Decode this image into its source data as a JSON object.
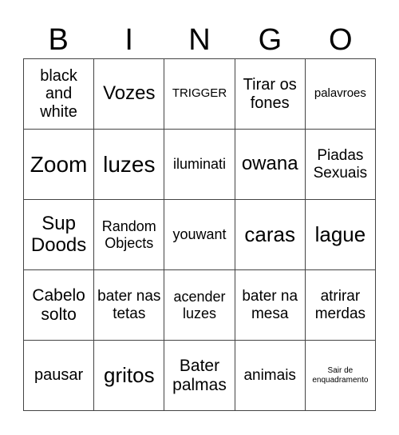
{
  "header": [
    "B",
    "I",
    "N",
    "G",
    "O"
  ],
  "cells": [
    [
      "black and white",
      "Vozes",
      "TRIGGER",
      "Tirar os fones",
      "palavroes"
    ],
    [
      "Zoom",
      "luzes",
      "iluminati",
      "owana",
      "Piadas Sexuais"
    ],
    [
      "Sup Doods",
      "Random Objects",
      "youwant",
      "caras",
      "lague"
    ],
    [
      "Cabelo solto",
      "bater nas tetas",
      "acender luzes",
      "bater na mesa",
      "atrirar merdas"
    ],
    [
      "pausar",
      "gritos",
      "Bater palmas",
      "animais",
      "Sair de enquadramento"
    ]
  ]
}
